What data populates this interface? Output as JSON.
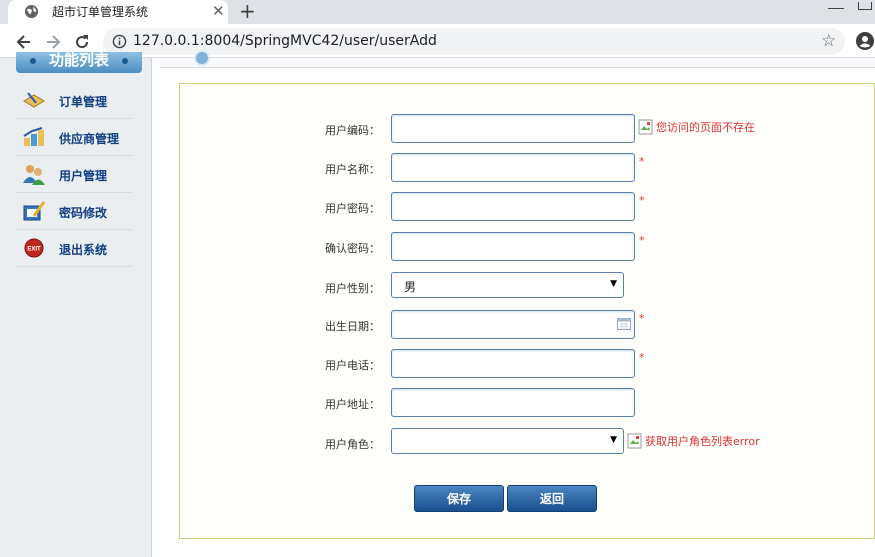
{
  "browser": {
    "tab_title": "超市订单管理系统",
    "tab_close": "✕",
    "new_tab": "+",
    "url": "127.0.0.1:8004/SpringMVC42/user/userAdd",
    "star": "☆",
    "icons": [
      "globe-icon",
      "back-icon",
      "forward-icon",
      "reload-icon",
      "info-icon",
      "bookmark-star-icon",
      "account-icon"
    ]
  },
  "sidebar": {
    "header": "功能列表",
    "items": [
      {
        "label": "订单管理",
        "icon": "order-icon"
      },
      {
        "label": "供应商管理",
        "icon": "supplier-icon"
      },
      {
        "label": "用户管理",
        "icon": "users-icon"
      },
      {
        "label": "密码修改",
        "icon": "password-edit-icon"
      },
      {
        "label": "退出系统",
        "icon": "exit-icon",
        "icon_text": "EXIT"
      }
    ]
  },
  "form": {
    "user_code": {
      "label": "用户编码：",
      "value": "",
      "message": "您访问的页面不存在"
    },
    "user_name": {
      "label": "用户名称：",
      "value": "",
      "required": "*"
    },
    "password": {
      "label": "用户密码：",
      "value": "",
      "required": "*"
    },
    "confirm_password": {
      "label": "确认密码：",
      "value": "",
      "required": "*"
    },
    "gender": {
      "label": "用户性别：",
      "value": "男",
      "caret": "▼"
    },
    "birthday": {
      "label": "出生日期：",
      "value": "",
      "required": "*"
    },
    "phone": {
      "label": "用户电话：",
      "value": "",
      "required": "*"
    },
    "address": {
      "label": "用户地址：",
      "value": ""
    },
    "role": {
      "label": "用户角色：",
      "value": "",
      "caret": "▼",
      "message": "获取用户角色列表error"
    },
    "save_label": "保存",
    "back_label": "返回"
  },
  "colors": {
    "accent": "#1a4f8e",
    "error": "#d33333",
    "form_border": "#c8d274",
    "menu_text": "#123f80"
  }
}
